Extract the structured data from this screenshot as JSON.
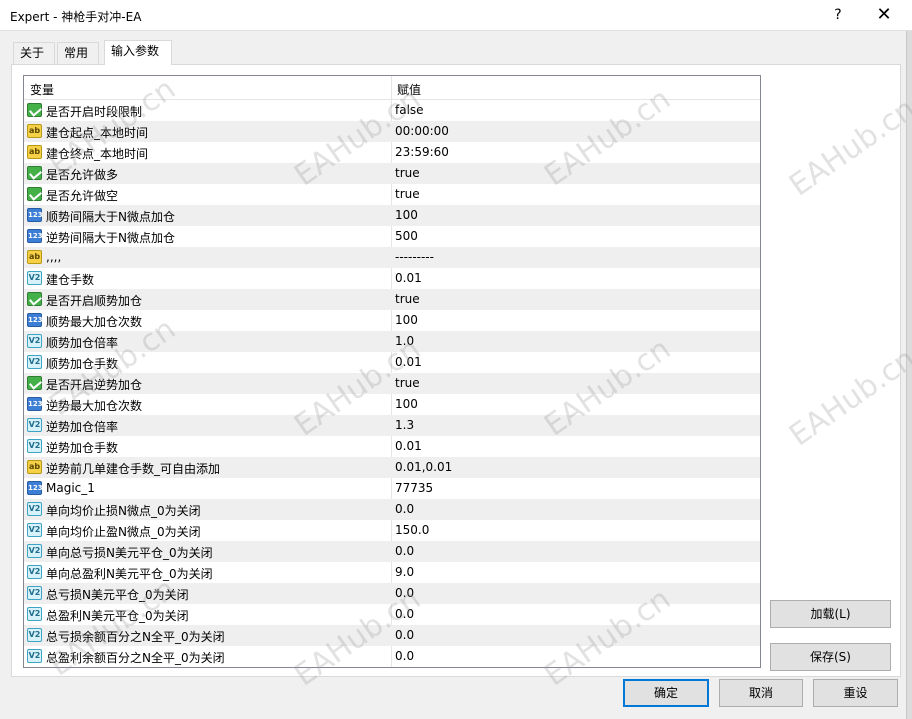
{
  "window": {
    "title": "Expert - 神枪手对冲-EA",
    "help_label": "?",
    "close_label": "✕"
  },
  "tabs": [
    {
      "label": "关于",
      "active": false
    },
    {
      "label": "常用",
      "active": false
    },
    {
      "label": "输入参数",
      "active": true
    }
  ],
  "table": {
    "header": {
      "variable": "变量",
      "value": "赋值"
    },
    "rows": [
      {
        "icon": "bool-icon",
        "name": "是否开启时段限制",
        "value": "false"
      },
      {
        "icon": "string-icon",
        "name": "建仓起点_本地时间",
        "value": "00:00:00"
      },
      {
        "icon": "string-icon",
        "name": "建仓终点_本地时间",
        "value": "23:59:60"
      },
      {
        "icon": "bool-icon",
        "name": "是否允许做多",
        "value": "true"
      },
      {
        "icon": "bool-icon",
        "name": "是否允许做空",
        "value": "true"
      },
      {
        "icon": "int-icon",
        "name": "顺势间隔大于N微点加仓",
        "value": "100"
      },
      {
        "icon": "int-icon",
        "name": "逆势间隔大于N微点加仓",
        "value": "500"
      },
      {
        "icon": "string-icon",
        "name": ",,,,",
        "value": "---------"
      },
      {
        "icon": "double-icon",
        "name": "建仓手数",
        "value": "0.01"
      },
      {
        "icon": "bool-icon",
        "name": "是否开启顺势加仓",
        "value": "true"
      },
      {
        "icon": "int-icon",
        "name": "顺势最大加仓次数",
        "value": "100"
      },
      {
        "icon": "double-icon",
        "name": "顺势加仓倍率",
        "value": "1.0"
      },
      {
        "icon": "double-icon",
        "name": "顺势加仓手数",
        "value": "0.01"
      },
      {
        "icon": "bool-icon",
        "name": "是否开启逆势加仓",
        "value": "true"
      },
      {
        "icon": "int-icon",
        "name": "逆势最大加仓次数",
        "value": "100"
      },
      {
        "icon": "double-icon",
        "name": "逆势加仓倍率",
        "value": "1.3"
      },
      {
        "icon": "double-icon",
        "name": "逆势加仓手数",
        "value": "0.01"
      },
      {
        "icon": "string-icon",
        "name": "逆势前几单建仓手数_可自由添加",
        "value": "0.01,0.01"
      },
      {
        "icon": "int-icon",
        "name": "Magic_1",
        "value": "77735"
      },
      {
        "icon": "double-icon",
        "name": "单向均价止损N微点_0为关闭",
        "value": "0.0"
      },
      {
        "icon": "double-icon",
        "name": "单向均价止盈N微点_0为关闭",
        "value": "150.0"
      },
      {
        "icon": "double-icon",
        "name": "单向总亏损N美元平仓_0为关闭",
        "value": "0.0"
      },
      {
        "icon": "double-icon",
        "name": "单向总盈利N美元平仓_0为关闭",
        "value": "9.0"
      },
      {
        "icon": "double-icon",
        "name": "总亏损N美元平仓_0为关闭",
        "value": "0.0"
      },
      {
        "icon": "double-icon",
        "name": "总盈利N美元平仓_0为关闭",
        "value": "0.0"
      },
      {
        "icon": "double-icon",
        "name": "总亏损余额百分之N全平_0为关闭",
        "value": "0.0"
      },
      {
        "icon": "double-icon",
        "name": "总盈利余额百分之N全平_0为关闭",
        "value": "0.0"
      }
    ]
  },
  "icon_glyphs": {
    "bool-icon": "",
    "string-icon": "ab",
    "int-icon": "123",
    "double-icon": "V2"
  },
  "buttons": {
    "load": "加载(L)",
    "save": "保存(S)",
    "ok": "确定",
    "cancel": "取消",
    "reset": "重设"
  },
  "watermark": "EAHub.cn",
  "colors": {
    "primary_border": "#0078d7",
    "bool_icon": "#43b048",
    "string_icon": "#f6d046",
    "int_icon": "#3d7fd6",
    "double_icon": "#d7f2fa"
  }
}
